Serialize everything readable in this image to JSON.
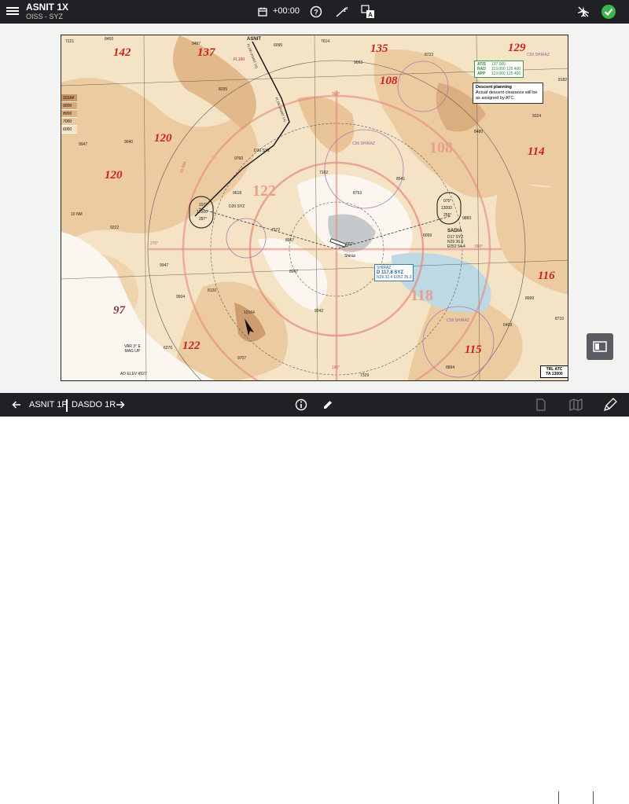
{
  "header": {
    "title": "ASNIT 1X",
    "subtitle": "OISS - SYZ",
    "time_offset": "+00:00"
  },
  "footer": {
    "prev_procedure": "ASNIT 1P",
    "next_procedure": "DASDO 1R"
  },
  "chart": {
    "frequencies": [
      {
        "label": "ATIS",
        "value": "127.000"
      },
      {
        "label": "RAD",
        "value": "119.000  125.400"
      },
      {
        "label": "APP",
        "value": "119.000  125.400"
      }
    ],
    "descent_title": "Descent planning",
    "descent_text": "Actual descent clearance will be as assigned by ATC.",
    "mora_labels": [
      "142",
      "137",
      "135",
      "129",
      "108",
      "120",
      "120",
      "108",
      "114",
      "122",
      "116",
      "118",
      "97",
      "122",
      "115"
    ],
    "altitude_legend": [
      "10164",
      "9000",
      "8000",
      "7000",
      "6000"
    ],
    "waypoints": {
      "asnit": "ASNIT",
      "sadia": "SADIA",
      "sadia_dme": "D17 SYZ",
      "sadia_lat": "N29 36.0",
      "sadia_lon": "E052 54.4",
      "d20_syz": "D20 SYZ",
      "d20_syz_left": "D20 SYZ"
    },
    "navaid": {
      "name": "SHIRAZ",
      "ident": "D 117.8 SYZ",
      "coords": "N29 32.4 E052 35.3"
    },
    "airport": {
      "name": "Shiraz"
    },
    "holds": {
      "left_inbound": "107°",
      "left_alt": "12500",
      "left_outbound": "287°",
      "right_inbound": "075°",
      "right_alt": "13000",
      "right_outbound": "255°"
    },
    "radials": {
      "r360": "360°",
      "r090": "090°",
      "r180": "180°",
      "r270": "270°",
      "r007": "007°"
    },
    "range_labels": [
      "25 NM",
      "10 NM"
    ],
    "magvar": "VAR 3° E\nMAG UP",
    "ad_elev": "AD ELEV 4927",
    "trl": "TRL ATC",
    "ta": "TA 13000",
    "restricted_areas": [
      "C59 SHIRAZ",
      "C58 SHIRAZ",
      "C56 SHIRAZ"
    ],
    "route_label": "FL160 (ASNIT 1X)",
    "fl160": "FL160",
    "spot_elevations": [
      "7221",
      "8450",
      "9497",
      "6095",
      "7614",
      "9063",
      "8723",
      "8182",
      "9324",
      "8480",
      "10164",
      "9947",
      "9040",
      "8255",
      "9760",
      "9618",
      "7162",
      "8541",
      "8753",
      "9883",
      "6059",
      "7572",
      "8067",
      "8047",
      "9947",
      "9504",
      "8120",
      "9242",
      "10164",
      "6276",
      "9707",
      "7329",
      "8894",
      "6469",
      "8999",
      "8710",
      "9222"
    ]
  }
}
